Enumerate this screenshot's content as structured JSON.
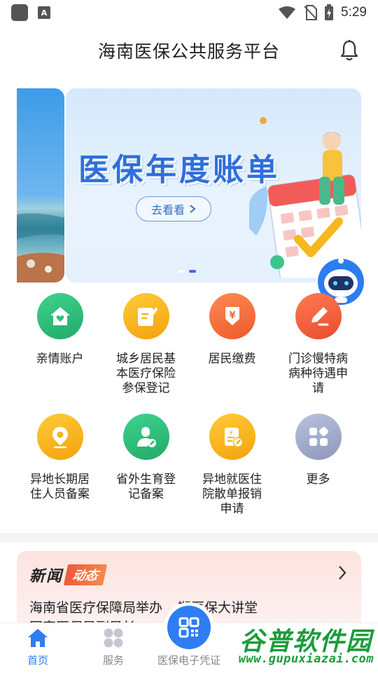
{
  "status_bar": {
    "time": "5:29",
    "notice_icon": "A"
  },
  "header": {
    "title": "海南医保公共服务平台"
  },
  "banner": {
    "title": "医保年度账单",
    "button_label": "去看看",
    "active_dot": 1,
    "dot_count": 2
  },
  "grid": [
    {
      "label": "亲情账户",
      "icon": "home-heart-icon",
      "color": "#2fc07a"
    },
    {
      "label": "城乡居民基本医疗保险参保登记",
      "icon": "document-edit-icon",
      "color": "#f7b21b"
    },
    {
      "label": "居民缴费",
      "icon": "yuan-download-icon",
      "color": "#f26b3a"
    },
    {
      "label": "门诊慢特病病种待遇申请",
      "icon": "pencil-icon",
      "color": "#f0603b"
    },
    {
      "label": "异地长期居住人员备案",
      "icon": "location-pin-icon",
      "color": "#f7b21b"
    },
    {
      "label": "省外生育登记备案",
      "icon": "person-edit-icon",
      "color": "#2fc07a"
    },
    {
      "label": "异地就医住院散单报销申请",
      "icon": "receipt-edit-icon",
      "color": "#f7b21b"
    },
    {
      "label": "更多",
      "icon": "apps-grid-icon",
      "color": "#8f9bc0"
    }
  ],
  "news": {
    "title_part1": "新闻",
    "title_part2": "动态",
    "line1": "海南省医疗保障局举办",
    "line1_tail": "期医保大讲堂",
    "line2": "国家医保局副局长"
  },
  "tabbar": {
    "home_label": "首页",
    "service_label": "服务",
    "qr_label": "医保电子凭证"
  },
  "watermark": {
    "big": "谷普软件园",
    "small": "www.gupuxiazai.com"
  }
}
